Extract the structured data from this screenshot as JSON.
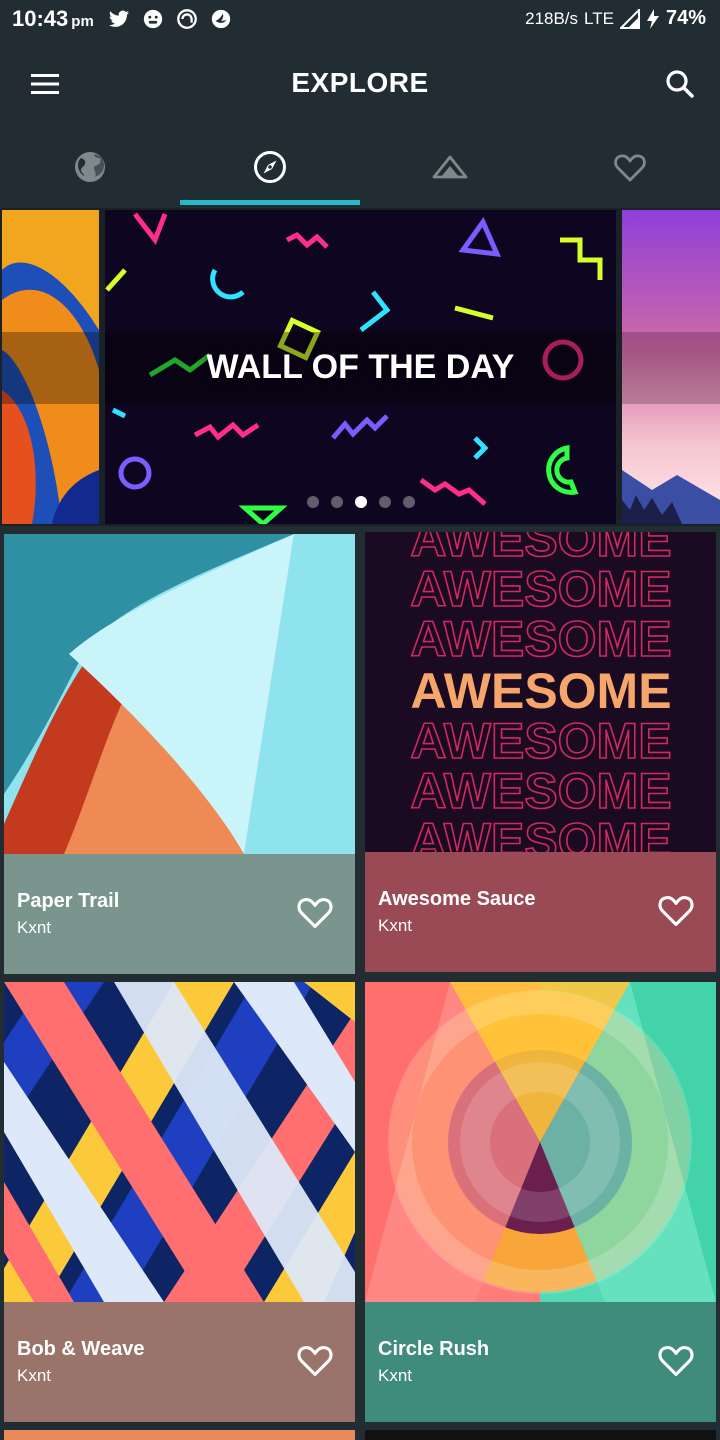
{
  "status_bar": {
    "time": "10:43",
    "ampm": "pm",
    "network_speed": "218B/s",
    "network_type": "LTE",
    "battery": "74%",
    "left_icons": [
      "twitter-icon",
      "face-icon",
      "vpn-icon",
      "app-icon"
    ]
  },
  "app_bar": {
    "title": "EXPLORE",
    "menu_icon": "hamburger-menu-icon",
    "search_icon": "search-icon"
  },
  "tabs": {
    "items": [
      {
        "icon": "globe-icon",
        "active": false
      },
      {
        "icon": "compass-icon",
        "active": true
      },
      {
        "icon": "mountain-icon",
        "active": false
      },
      {
        "icon": "heart-icon",
        "active": false
      }
    ],
    "accent": "#26b8c9"
  },
  "carousel": {
    "title": "WALL OF THE DAY",
    "page_count": 5,
    "active_page": 3
  },
  "wallpapers": [
    {
      "name": "Paper Trail",
      "author": "Kxnt",
      "info_color": "#7a958d"
    },
    {
      "name": "Awesome Sauce",
      "author": "Kxnt",
      "info_color": "#9a4a55"
    },
    {
      "name": "Bob & Weave",
      "author": "Kxnt",
      "info_color": "#9a736b"
    },
    {
      "name": "Circle Rush",
      "author": "Kxnt",
      "info_color": "#3f8c7c"
    }
  ],
  "awesome_art": {
    "word": "AWESOME"
  },
  "colors": {
    "background": "#222d33",
    "accent": "#26b8c9"
  }
}
